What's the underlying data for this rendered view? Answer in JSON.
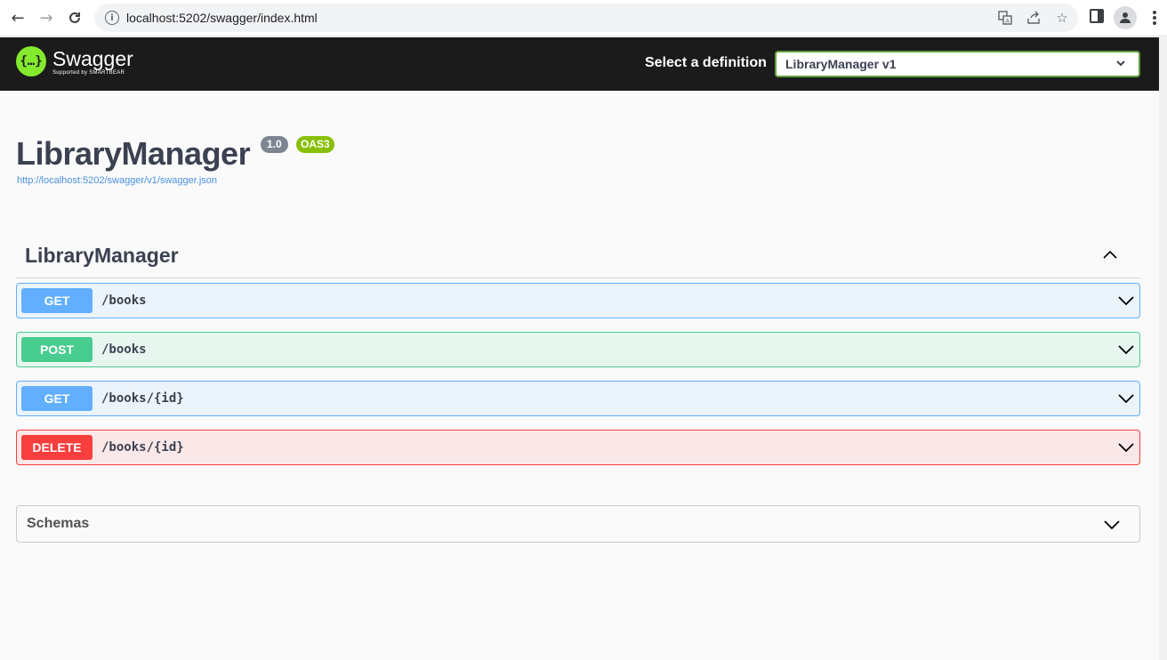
{
  "browser": {
    "url": "localhost:5202/swagger/index.html"
  },
  "topbar": {
    "logo_name": "Swagger",
    "logo_sub": "Supported by SMARTBEAR",
    "logo_glyph": "{…}",
    "select_label": "Select a definition",
    "select_value": "LibraryManager v1"
  },
  "info": {
    "title": "LibraryManager",
    "version": "1.0",
    "oas": "OAS3",
    "spec_url": "http://localhost:5202/swagger/v1/swagger.json"
  },
  "tag": {
    "title": "LibraryManager"
  },
  "operations": [
    {
      "method": "GET",
      "path": "/books"
    },
    {
      "method": "POST",
      "path": "/books"
    },
    {
      "method": "GET",
      "path": "/books/{id}"
    },
    {
      "method": "DELETE",
      "path": "/books/{id}"
    }
  ],
  "schemas": {
    "title": "Schemas"
  },
  "colors": {
    "get": "#61affe",
    "post": "#49cc90",
    "delete": "#f93e3e",
    "topbar": "#1b1b1b",
    "logo": "#85ea2d",
    "oas_badge": "#89bf04",
    "version_badge": "#7d8492"
  }
}
